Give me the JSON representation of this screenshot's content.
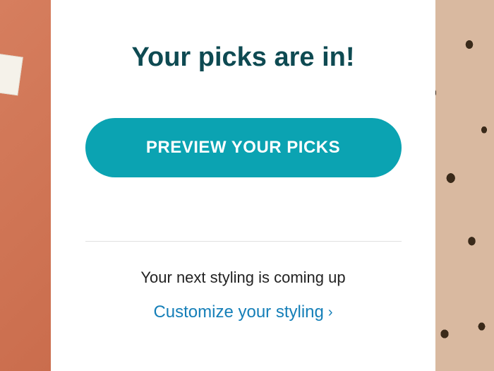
{
  "colors": {
    "accent": "#0ba3b2",
    "title": "#0e4a52",
    "link": "#157fb8"
  },
  "card": {
    "title": "Your picks are in!",
    "cta_label": "PREVIEW YOUR PICKS",
    "next_styling_text": "Your next styling is coming up",
    "customize_link_label": "Customize your styling"
  }
}
